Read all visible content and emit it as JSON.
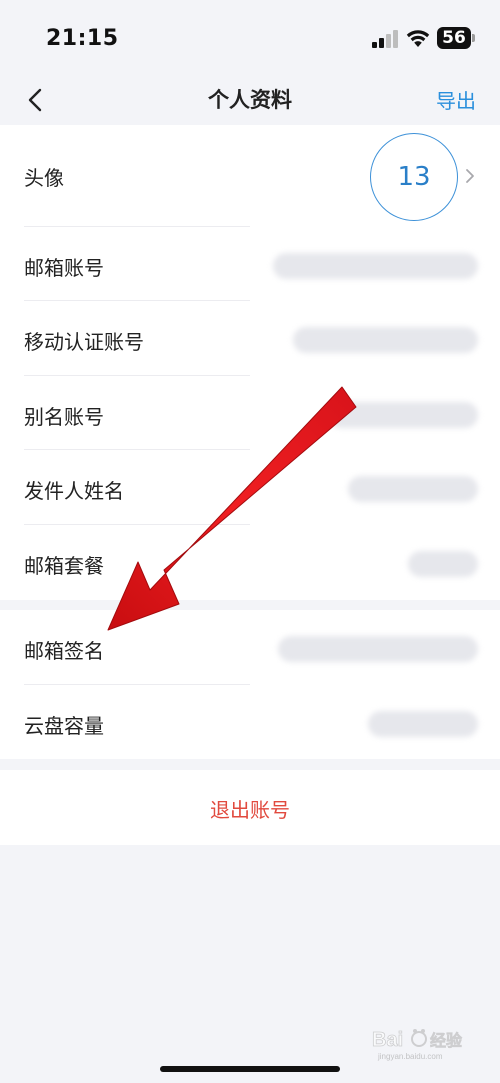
{
  "status_bar": {
    "time": "21:15",
    "battery": "56",
    "icons": [
      "signal-icon",
      "wifi-icon",
      "battery-icon"
    ]
  },
  "nav": {
    "title": "个人资料",
    "export_label": "导出",
    "back_icon": "chevron-left-icon",
    "accent_color": "#2a8fdc"
  },
  "profile": {
    "avatar_label": "头像",
    "avatar_text": "13",
    "rows": [
      {
        "key": "email_account",
        "label": "邮箱账号",
        "value_blurred": true
      },
      {
        "key": "mobile_auth_account",
        "label": "移动认证账号",
        "value_blurred": true
      },
      {
        "key": "alias_account",
        "label": "别名账号",
        "value_blurred": true
      },
      {
        "key": "sender_name",
        "label": "发件人姓名",
        "value_blurred": true
      },
      {
        "key": "mailbox_plan",
        "label": "邮箱套餐",
        "value_blurred": true
      }
    ],
    "rows_2": [
      {
        "key": "mail_signature",
        "label": "邮箱签名",
        "value_blurred": true
      },
      {
        "key": "cloud_capacity",
        "label": "云盘容量",
        "value_blurred": true
      }
    ]
  },
  "logout": {
    "label": "退出账号",
    "color": "#e14a3e"
  },
  "annotation": {
    "type": "red-arrow",
    "points_to": "邮箱签名",
    "color": "#e8161b"
  },
  "watermark": {
    "text": "Bai 经验",
    "subtext": "jingyan.baidu.com"
  }
}
